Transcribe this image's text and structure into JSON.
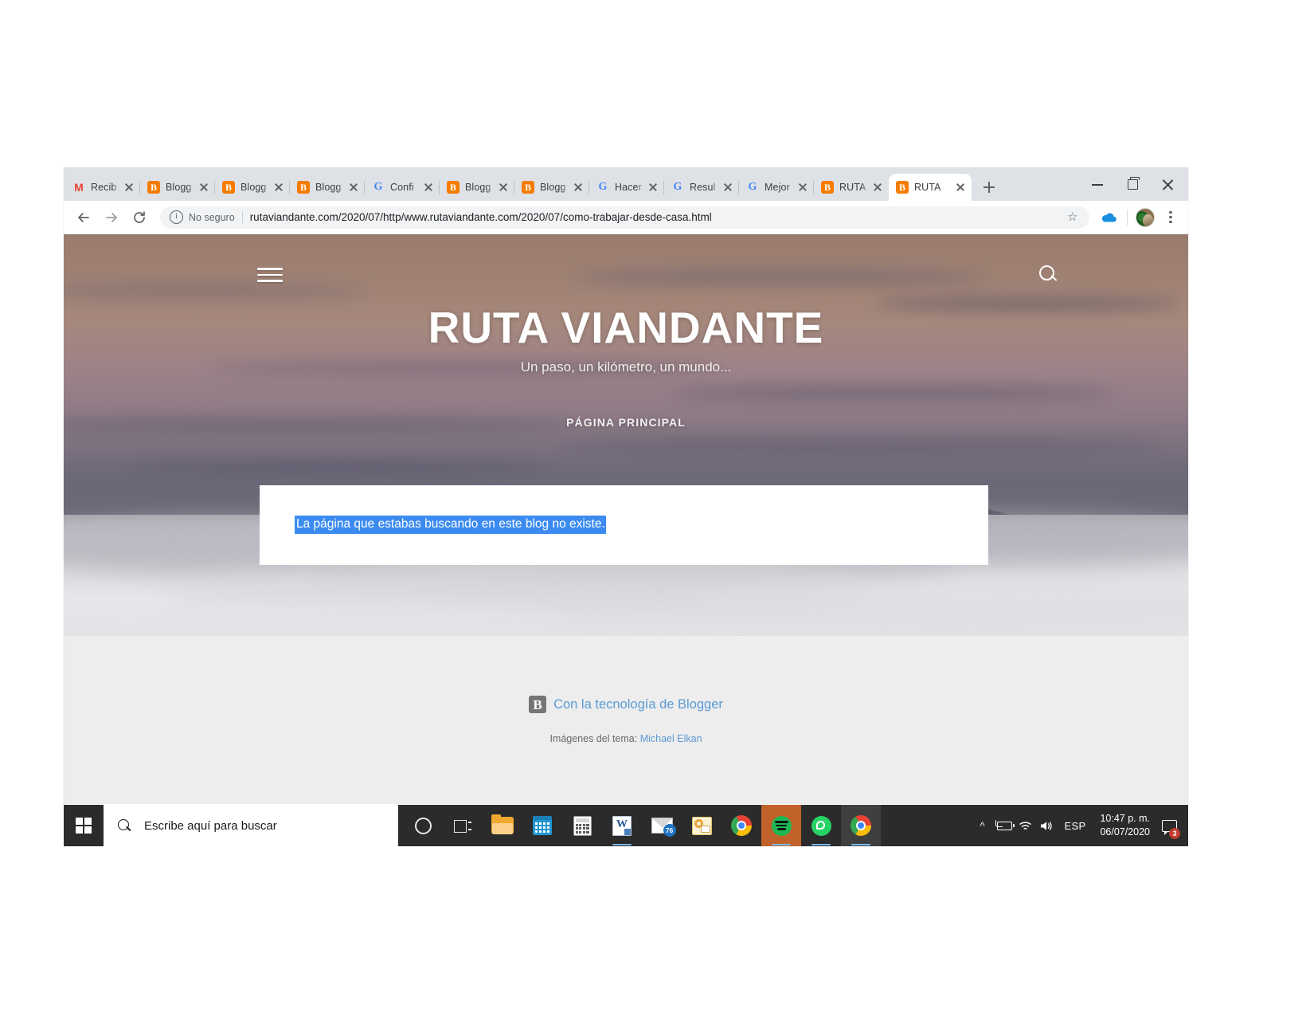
{
  "browser": {
    "tabs": [
      {
        "title": "Recib",
        "favicon": "gmail-icon",
        "active": false
      },
      {
        "title": "Blogg",
        "favicon": "blogger-icon",
        "active": false
      },
      {
        "title": "Blogg",
        "favicon": "blogger-icon",
        "active": false
      },
      {
        "title": "Blogg",
        "favicon": "blogger-icon",
        "active": false
      },
      {
        "title": "Confi",
        "favicon": "google-icon",
        "active": false
      },
      {
        "title": "Blogg",
        "favicon": "blogger-icon",
        "active": false
      },
      {
        "title": "Blogg",
        "favicon": "blogger-icon",
        "active": false
      },
      {
        "title": "Hacer",
        "favicon": "google-icon",
        "active": false
      },
      {
        "title": "Resul",
        "favicon": "google-icon",
        "active": false
      },
      {
        "title": "Mejor",
        "favicon": "google-icon",
        "active": false
      },
      {
        "title": "RUTA",
        "favicon": "blogger-icon",
        "active": false
      },
      {
        "title": "RUTA",
        "favicon": "blogger-icon",
        "active": true
      }
    ],
    "new_tab_label": "+",
    "window_controls": {
      "minimize": "minimize-button",
      "maximize": "maximize-button",
      "close": "close-button"
    },
    "toolbar": {
      "back": "back-button",
      "forward": "forward-button",
      "reload": "reload-button",
      "security_label": "No seguro",
      "url": "rutaviandante.com/2020/07/http/www.rutaviandante.com/2020/07/como-trabajar-desde-casa.html",
      "bookmark": "☆",
      "extension": "onedrive-icon",
      "profile": "avatar",
      "menu": "chrome-menu-button"
    }
  },
  "page": {
    "menu_button": "hamburger-menu",
    "search_button": "search-icon",
    "site_title": "RUTA VIANDANTE",
    "tagline": "Un paso, un kilómetro, un mundo...",
    "nav": [
      {
        "label": "PÁGINA PRINCIPAL"
      }
    ],
    "error_message": "La página que estabas buscando en este blog no existe.",
    "footer": {
      "blogger_mark": "B",
      "powered_by": "Con la tecnología de Blogger",
      "theme_credit_prefix": "Imágenes del tema:",
      "theme_author": "Michael Elkan"
    }
  },
  "taskbar": {
    "start": "windows-start-button",
    "search_placeholder": "Escribe aquí para buscar",
    "items": [
      {
        "name": "cortana-button",
        "label": "Cortana"
      },
      {
        "name": "task-view-button",
        "label": "Vista de tareas"
      },
      {
        "name": "file-explorer-button",
        "label": "Explorador de archivos"
      },
      {
        "name": "calendar-button",
        "label": "Calendario"
      },
      {
        "name": "calculator-button",
        "label": "Calculadora"
      },
      {
        "name": "word-button",
        "label": "Word"
      },
      {
        "name": "mail-button",
        "label": "Correo",
        "badge": "76"
      },
      {
        "name": "outlook-button",
        "label": "Outlook"
      },
      {
        "name": "chrome-button",
        "label": "Google Chrome"
      },
      {
        "name": "spotify-button",
        "label": "Spotify"
      },
      {
        "name": "whatsapp-button",
        "label": "WhatsApp"
      },
      {
        "name": "chrome-active-button",
        "label": "Google Chrome"
      }
    ],
    "tray": {
      "chevron": "^",
      "battery": "battery-charging-icon",
      "wifi": "wifi-icon",
      "volume": "volume-icon",
      "language": "ESP",
      "time": "10:47 p. m.",
      "date": "06/07/2020",
      "notification_count": "3"
    }
  },
  "colors": {
    "chrome_tabstrip": "#dee1e6",
    "selection_blue": "#3b8bf0",
    "blogger_orange": "#f57c00",
    "link_blue": "#5b9bd5",
    "taskbar": "#2b2b2b",
    "footer_gray": "#ededed",
    "spotify_highlight": "#c1622a"
  }
}
